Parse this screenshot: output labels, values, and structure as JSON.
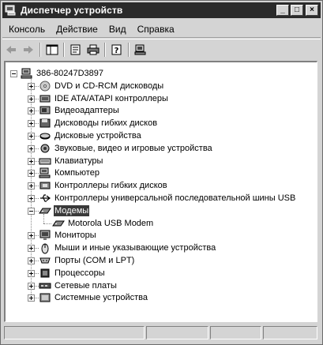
{
  "window": {
    "title": "Диспетчер устройств",
    "buttons": {
      "minimize": "_",
      "maximize": "□",
      "close": "×"
    }
  },
  "menu": [
    "Консоль",
    "Действие",
    "Вид",
    "Справка"
  ],
  "toolbar": [
    "back-arrow-icon",
    "forward-arrow-icon",
    "console-tree-icon",
    "properties-icon",
    "print-icon",
    "help-icon",
    "scan-hardware-icon"
  ],
  "tree": {
    "root": "386-80247D3897",
    "categories": [
      {
        "label": "DVD и CD-RCM дисководы",
        "icon": "cdrom-icon"
      },
      {
        "label": "IDE ATA/ATAPI контроллеры",
        "icon": "ide-controller-icon"
      },
      {
        "label": "Видеоадаптеры",
        "icon": "display-adapter-icon"
      },
      {
        "label": "Дисководы гибких дисков",
        "icon": "floppy-drive-icon"
      },
      {
        "label": "Дисковые устройства",
        "icon": "disk-drive-icon"
      },
      {
        "label": "Звуковые, видео и игровые устройства",
        "icon": "sound-icon"
      },
      {
        "label": "Клавиатуры",
        "icon": "keyboard-icon"
      },
      {
        "label": "Компьютер",
        "icon": "computer-icon"
      },
      {
        "label": "Контроллеры гибких дисков",
        "icon": "floppy-controller-icon"
      },
      {
        "label": "Контроллеры универсальной последовательной шины USB",
        "icon": "usb-icon"
      },
      {
        "label": "Модемы",
        "icon": "modem-icon",
        "expanded": true,
        "selected": true,
        "children": [
          {
            "label": "Motorola USB Modem",
            "icon": "modem-icon"
          }
        ]
      },
      {
        "label": "Мониторы",
        "icon": "monitor-icon"
      },
      {
        "label": "Мыши и иные указывающие устройства",
        "icon": "mouse-icon"
      },
      {
        "label": "Порты (COM и LPT)",
        "icon": "port-icon"
      },
      {
        "label": "Процессоры",
        "icon": "processor-icon"
      },
      {
        "label": "Сетевые платы",
        "icon": "network-card-icon"
      },
      {
        "label": "Системные устройства",
        "icon": "system-devices-icon"
      }
    ]
  },
  "statusbar": {
    "panels": [
      "",
      "",
      "",
      ""
    ]
  }
}
